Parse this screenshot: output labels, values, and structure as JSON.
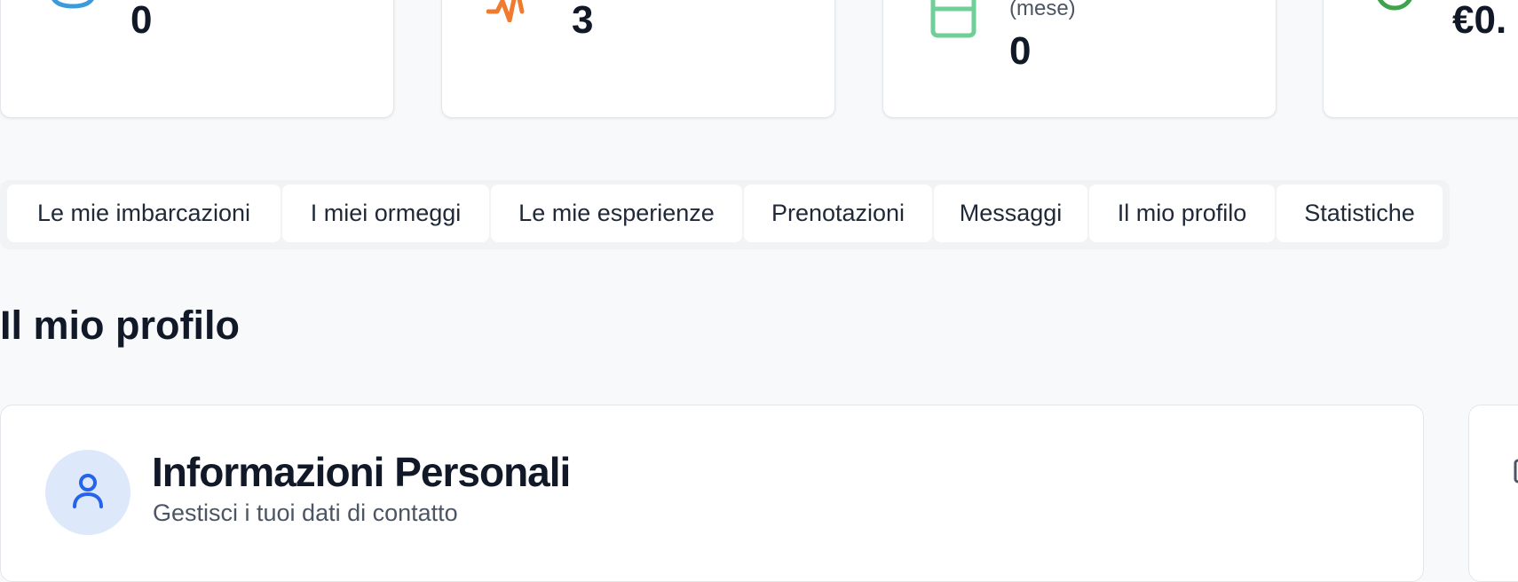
{
  "colors": {
    "page_bg": "#f8f9fb",
    "card_bg": "#ffffff",
    "tab_bar_bg": "#f1f3f5",
    "text_primary": "#111827",
    "text_secondary": "#4b5563",
    "icon_blue": "#3b9ad9",
    "icon_orange": "#f07b2f",
    "icon_green": "#6fcf97",
    "icon_euro_green": "#3fa34d",
    "avatar_bg": "#dde8fb",
    "avatar_icon": "#2563eb"
  },
  "stats": [
    {
      "icon": "boat-icon",
      "label": "",
      "value": "0"
    },
    {
      "icon": "activity-icon",
      "label": "",
      "value": "3"
    },
    {
      "icon": "calendar-icon",
      "label": "(mese)",
      "value": "0"
    },
    {
      "icon": "euro-icon",
      "label": "",
      "value": "€0."
    }
  ],
  "tabs": [
    "Le mie imbarcazioni",
    "I miei ormeggi",
    "Le mie esperienze",
    "Prenotazioni",
    "Messaggi",
    "Il mio profilo",
    "Statistiche"
  ],
  "page_title": "Il mio profilo",
  "profile_card": {
    "icon": "user-icon",
    "title": "Informazioni Personali",
    "subtitle": "Gestisci i tuoi dati di contatto"
  }
}
